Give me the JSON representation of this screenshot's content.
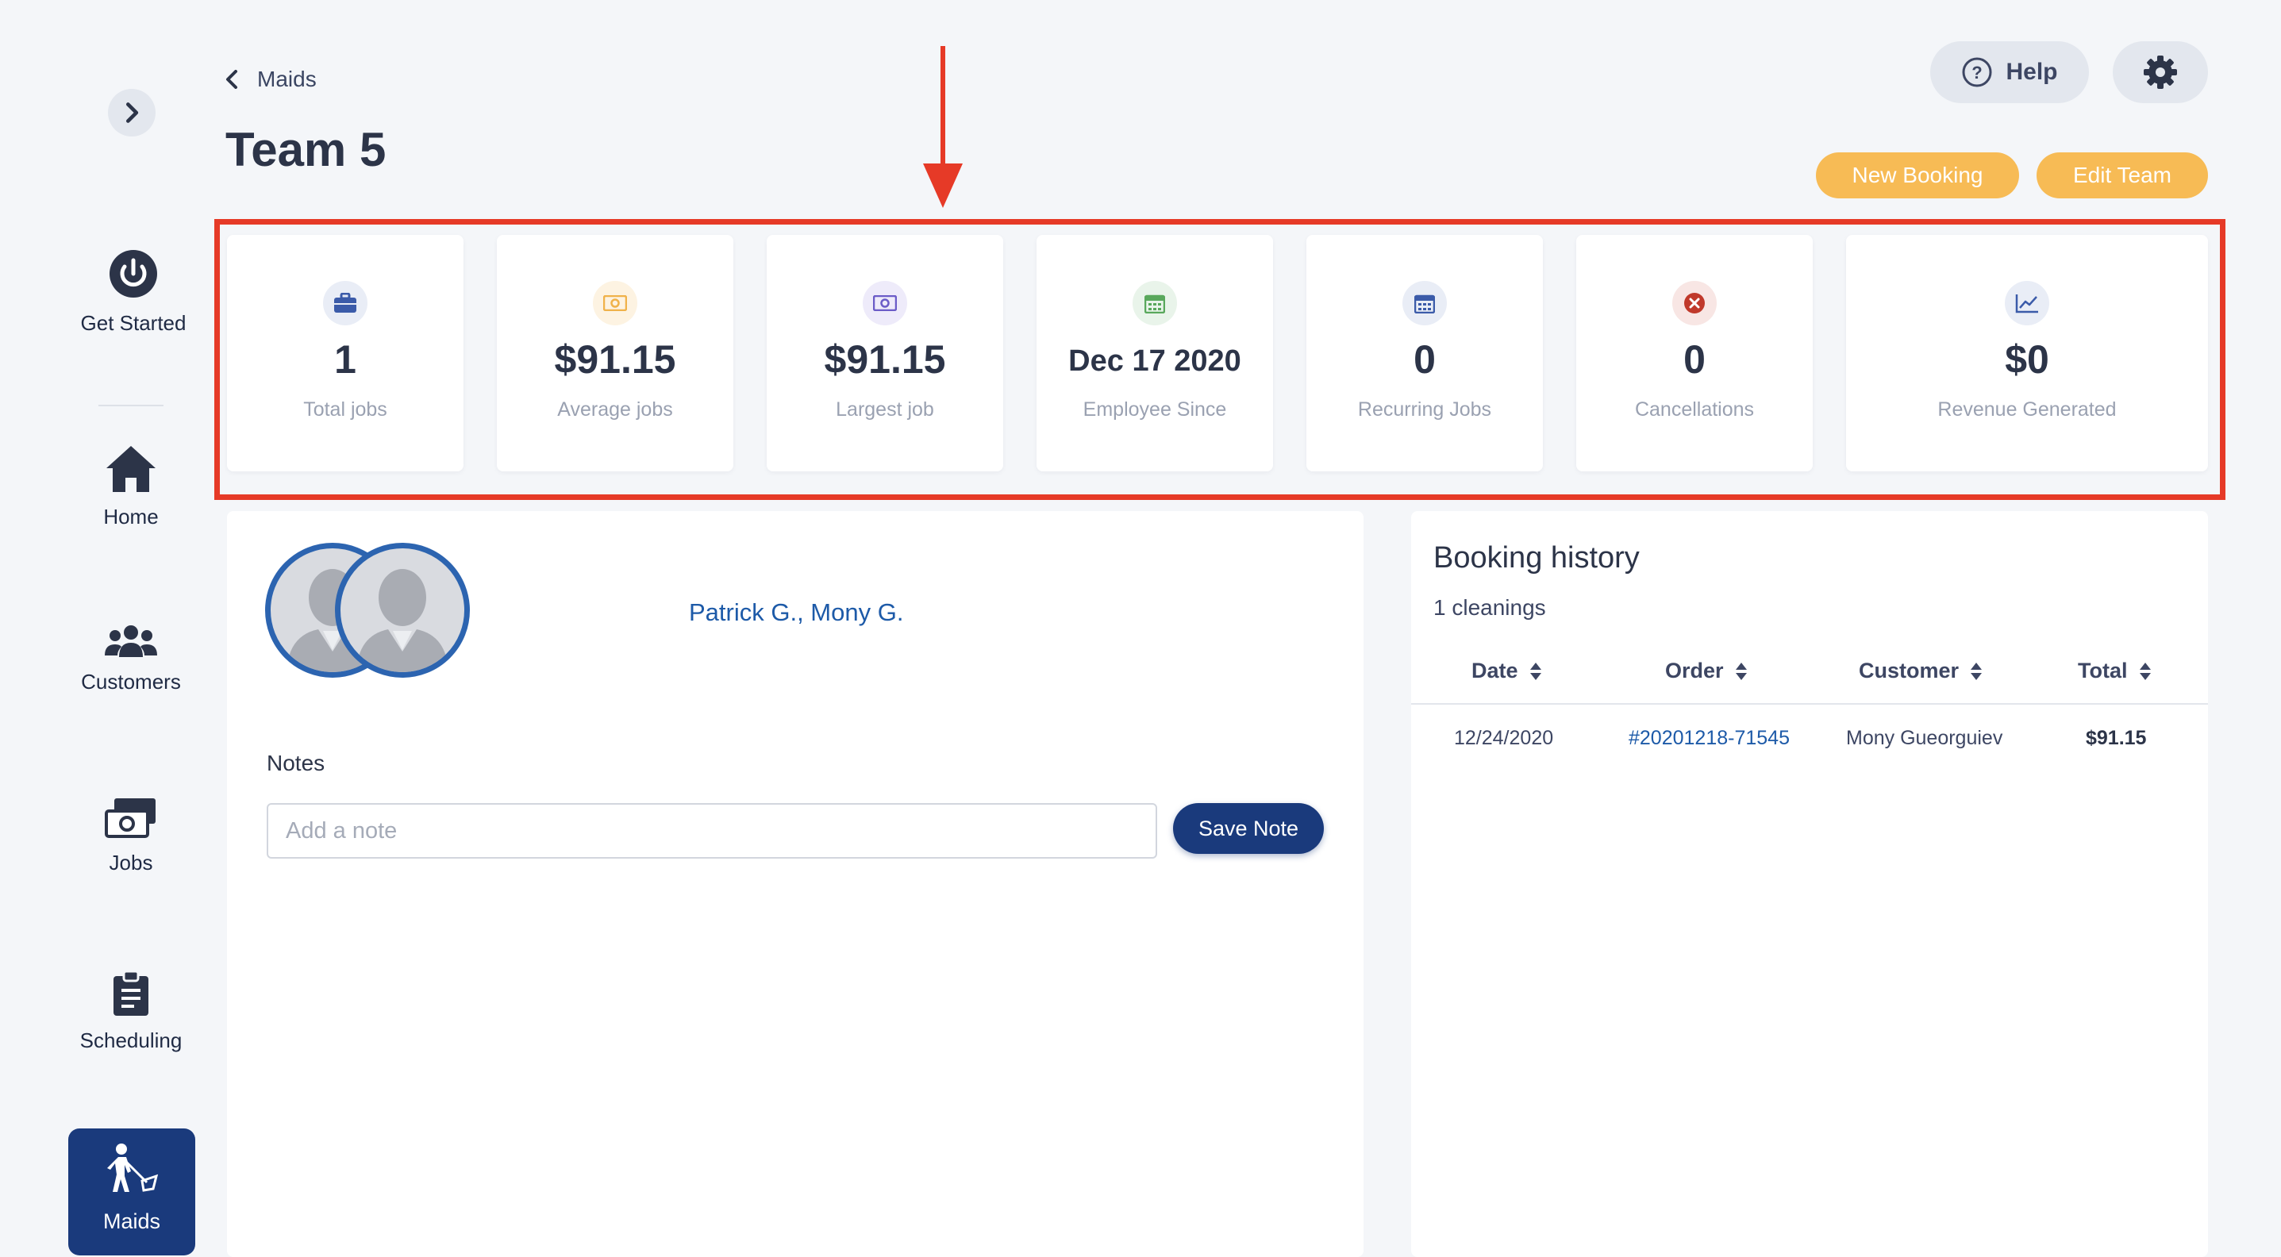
{
  "sidebar": {
    "items": [
      {
        "label": "Get Started",
        "icon": "power-icon"
      },
      {
        "label": "Home",
        "icon": "home-icon"
      },
      {
        "label": "Customers",
        "icon": "users-icon"
      },
      {
        "label": "Jobs",
        "icon": "money-stack-icon"
      },
      {
        "label": "Scheduling",
        "icon": "clipboard-icon"
      },
      {
        "label": "Maids",
        "icon": "maid-icon",
        "active": true
      }
    ]
  },
  "header": {
    "breadcrumb": "Maids",
    "title": "Team 5",
    "help_label": "Help",
    "new_booking_label": "New Booking",
    "edit_team_label": "Edit Team"
  },
  "stats": [
    {
      "value": "1",
      "label": "Total jobs",
      "icon": "briefcase-icon",
      "color": "#3b5ba9"
    },
    {
      "value": "$91.15",
      "label": "Average jobs",
      "icon": "money-icon",
      "color": "#f0b24a"
    },
    {
      "value": "$91.15",
      "label": "Largest job",
      "icon": "money-icon",
      "color": "#6b5cc7"
    },
    {
      "value": "Dec 17 2020",
      "label": "Employee Since",
      "icon": "calendar-icon",
      "color": "#59a85c"
    },
    {
      "value": "0",
      "label": "Recurring Jobs",
      "icon": "calendar-icon",
      "color": "#3b5ba9"
    },
    {
      "value": "0",
      "label": "Cancellations",
      "icon": "cancel-icon",
      "color": "#c0392b"
    },
    {
      "value": "$0",
      "label": "Revenue Generated",
      "icon": "chart-line-icon",
      "color": "#3b5ba9"
    }
  ],
  "team": {
    "members": "Patrick G., Mony G.",
    "notes_label": "Notes",
    "note_placeholder": "Add a note",
    "note_value": "",
    "save_label": "Save Note"
  },
  "booking_history": {
    "title": "Booking history",
    "count": "1 cleanings",
    "columns": [
      "Date",
      "Order",
      "Customer",
      "Total"
    ],
    "rows": [
      {
        "date": "12/24/2020",
        "order": "#20201218-71545",
        "customer": "Mony Gueorguiev",
        "total": "$91.15"
      }
    ]
  },
  "colors": {
    "accent": "#f7bb55",
    "primary": "#1a3a7c",
    "highlight": "#e63a27",
    "link": "#1d5aa8"
  }
}
